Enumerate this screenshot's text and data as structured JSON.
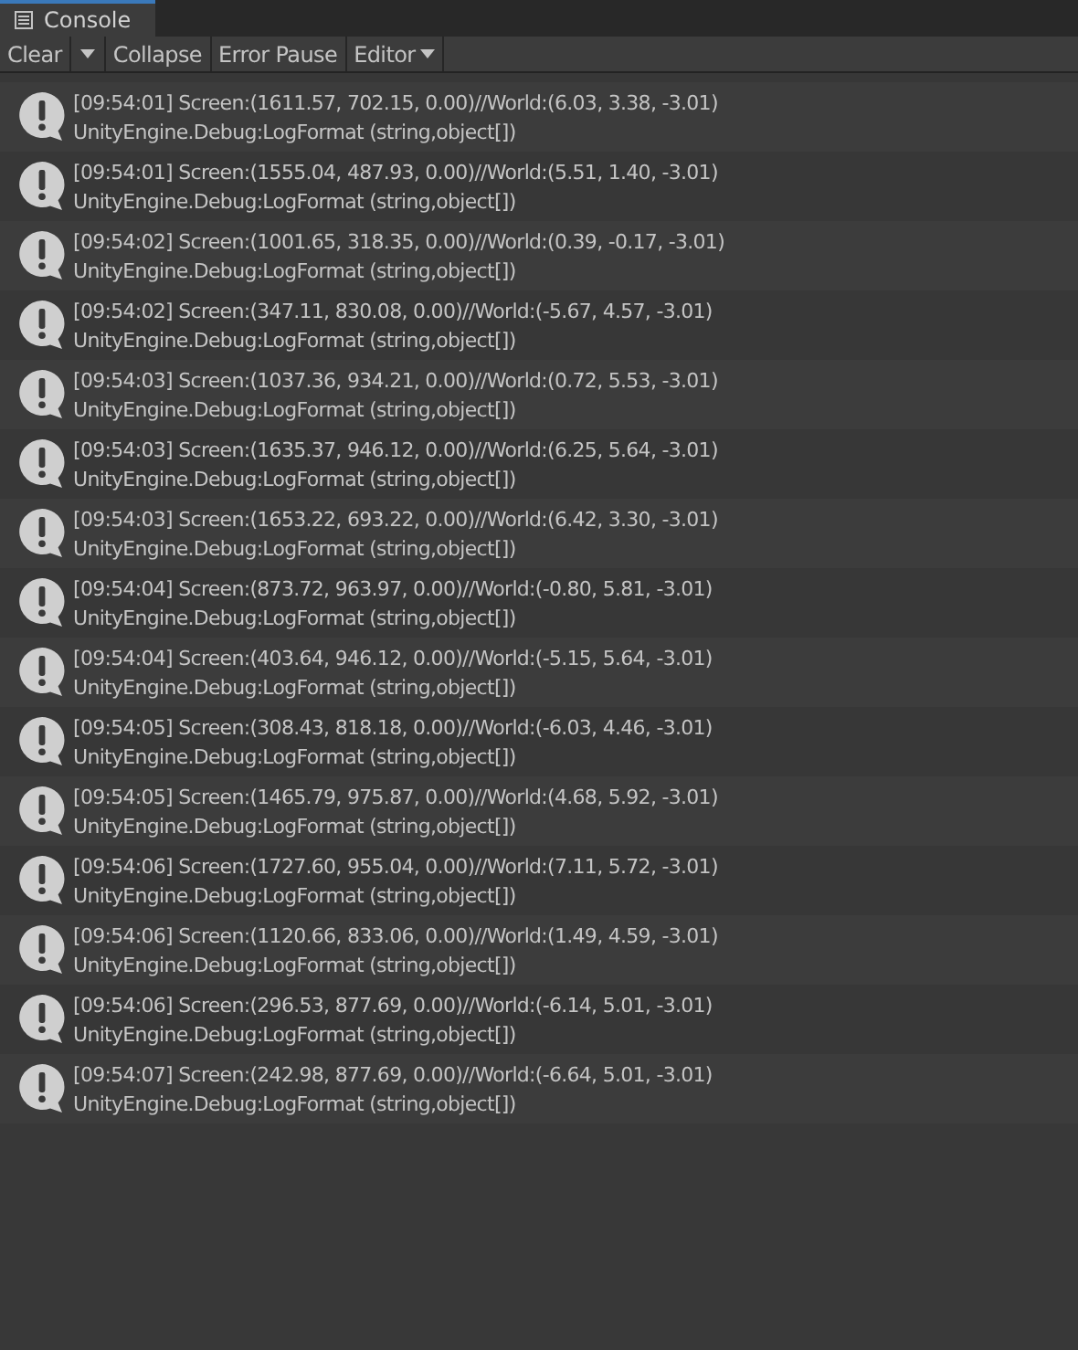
{
  "tab": {
    "label": "Console",
    "selected": true
  },
  "toolbar": [
    {
      "label": "Clear",
      "kind": "split"
    },
    {
      "label": "Collapse",
      "kind": "toggle"
    },
    {
      "label": "Error Pause",
      "kind": "toggle"
    },
    {
      "label": "Editor",
      "kind": "dropdown"
    }
  ],
  "entries": [
    {
      "message": "[09:54:01] Screen:(1611.57, 702.15, 0.00)//World:(6.03, 3.38, -3.01)",
      "trace": "UnityEngine.Debug:LogFormat (string,object[])"
    },
    {
      "message": "[09:54:01] Screen:(1555.04, 487.93, 0.00)//World:(5.51, 1.40, -3.01)",
      "trace": "UnityEngine.Debug:LogFormat (string,object[])"
    },
    {
      "message": "[09:54:02] Screen:(1001.65, 318.35, 0.00)//World:(0.39, -0.17, -3.01)",
      "trace": "UnityEngine.Debug:LogFormat (string,object[])"
    },
    {
      "message": "[09:54:02] Screen:(347.11, 830.08, 0.00)//World:(-5.67, 4.57, -3.01)",
      "trace": "UnityEngine.Debug:LogFormat (string,object[])"
    },
    {
      "message": "[09:54:03] Screen:(1037.36, 934.21, 0.00)//World:(0.72, 5.53, -3.01)",
      "trace": "UnityEngine.Debug:LogFormat (string,object[])"
    },
    {
      "message": "[09:54:03] Screen:(1635.37, 946.12, 0.00)//World:(6.25, 5.64, -3.01)",
      "trace": "UnityEngine.Debug:LogFormat (string,object[])"
    },
    {
      "message": "[09:54:03] Screen:(1653.22, 693.22, 0.00)//World:(6.42, 3.30, -3.01)",
      "trace": "UnityEngine.Debug:LogFormat (string,object[])"
    },
    {
      "message": "[09:54:04] Screen:(873.72, 963.97, 0.00)//World:(-0.80, 5.81, -3.01)",
      "trace": "UnityEngine.Debug:LogFormat (string,object[])"
    },
    {
      "message": "[09:54:04] Screen:(403.64, 946.12, 0.00)//World:(-5.15, 5.64, -3.01)",
      "trace": "UnityEngine.Debug:LogFormat (string,object[])"
    },
    {
      "message": "[09:54:05] Screen:(308.43, 818.18, 0.00)//World:(-6.03, 4.46, -3.01)",
      "trace": "UnityEngine.Debug:LogFormat (string,object[])"
    },
    {
      "message": "[09:54:05] Screen:(1465.79, 975.87, 0.00)//World:(4.68, 5.92, -3.01)",
      "trace": "UnityEngine.Debug:LogFormat (string,object[])"
    },
    {
      "message": "[09:54:06] Screen:(1727.60, 955.04, 0.00)//World:(7.11, 5.72, -3.01)",
      "trace": "UnityEngine.Debug:LogFormat (string,object[])"
    },
    {
      "message": "[09:54:06] Screen:(1120.66, 833.06, 0.00)//World:(1.49, 4.59, -3.01)",
      "trace": "UnityEngine.Debug:LogFormat (string,object[])"
    },
    {
      "message": "[09:54:06] Screen:(296.53, 877.69, 0.00)//World:(-6.14, 5.01, -3.01)",
      "trace": "UnityEngine.Debug:LogFormat (string,object[])"
    },
    {
      "message": "[09:54:07] Screen:(242.98, 877.69, 0.00)//World:(-6.64, 5.01, -3.01)",
      "trace": "UnityEngine.Debug:LogFormat (string,object[])"
    }
  ]
}
